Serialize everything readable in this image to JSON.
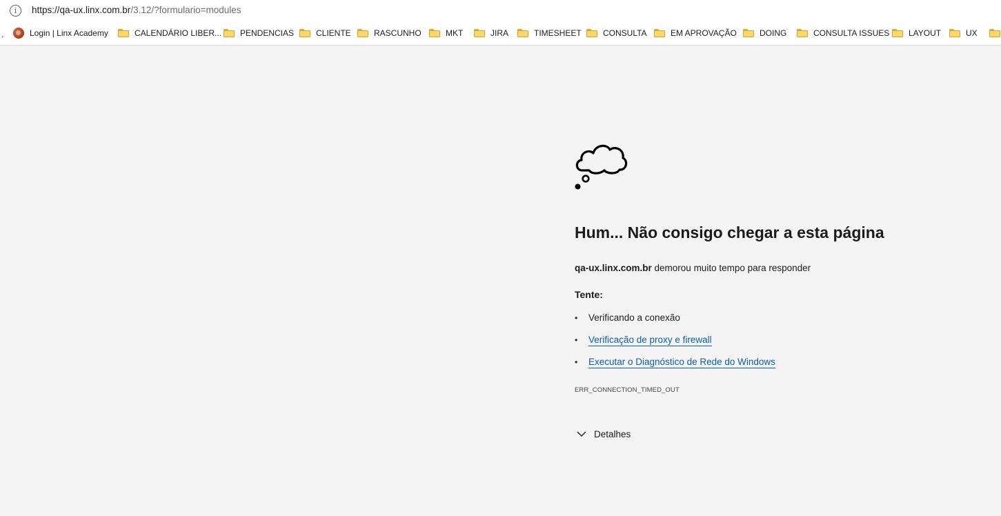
{
  "address_bar": {
    "url_host": "https://qa-ux.linx.com.br",
    "url_path": "/3.12/?formulario=modules",
    "info_icon": "info-icon"
  },
  "bookmarks": {
    "overflow_marker": ".",
    "items": [
      {
        "label": "Login | Linx Academy",
        "icon": "site-favicon"
      },
      {
        "label": "CALENDÁRIO LIBER...",
        "icon": "folder-icon"
      },
      {
        "label": "PENDENCIAS",
        "icon": "folder-icon"
      },
      {
        "label": "CLIENTE",
        "icon": "folder-icon"
      },
      {
        "label": "RASCUNHO",
        "icon": "folder-icon"
      },
      {
        "label": "MKT",
        "icon": "folder-icon"
      },
      {
        "label": "JIRA",
        "icon": "folder-icon"
      },
      {
        "label": "TIMESHEET",
        "icon": "folder-icon"
      },
      {
        "label": "CONSULTA",
        "icon": "folder-icon"
      },
      {
        "label": "EM APROVAÇÃO",
        "icon": "folder-icon"
      },
      {
        "label": "DOING",
        "icon": "folder-icon"
      },
      {
        "label": "CONSULTA ISSUES",
        "icon": "folder-icon"
      },
      {
        "label": "LAYOUT",
        "icon": "folder-icon"
      },
      {
        "label": "UX",
        "icon": "folder-icon"
      },
      {
        "label": "",
        "icon": "folder-icon"
      }
    ]
  },
  "error": {
    "icon": "thought-cloud-icon",
    "title": "Hum... Não consigo chegar a esta página",
    "host": "qa-ux.linx.com.br",
    "message": " demorou muito tempo para responder",
    "try_label": "Tente:",
    "suggestions": [
      {
        "text": "Verificando a conexão",
        "link": false
      },
      {
        "text": "Verificação de proxy e firewall",
        "link": true
      },
      {
        "text": "Executar o Diagnóstico de Rede do Windows",
        "link": true
      }
    ],
    "bullet": "•",
    "error_code": "ERR_CONNECTION_TIMED_OUT",
    "details_label": "Detalhes"
  },
  "colors": {
    "page_background": "#f4f4f4",
    "link": "#0b5cad",
    "folder": "#f8d775"
  }
}
